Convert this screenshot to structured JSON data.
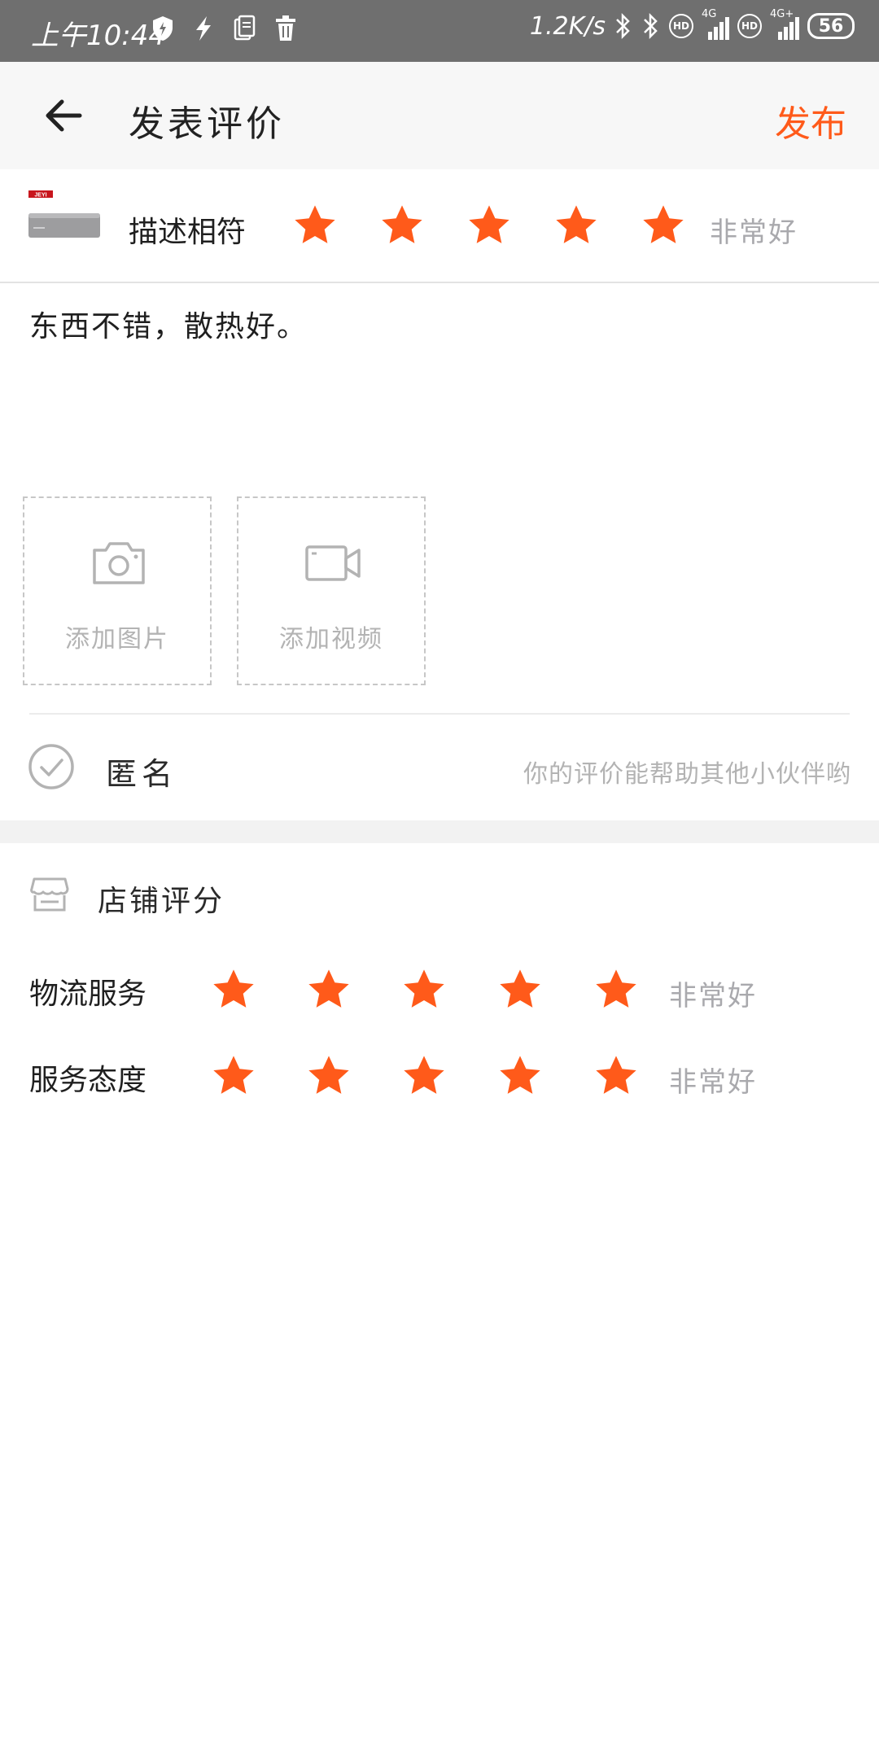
{
  "status_bar": {
    "time": "上午10:44",
    "net_speed": "1.2K/s",
    "network_1": "4G",
    "network_2": "4G+",
    "hd_badge": "HD",
    "battery": "56"
  },
  "header": {
    "title": "发表评价",
    "publish_label": "发布"
  },
  "product": {
    "brand_text": "JEYI",
    "rating_label": "描述相符",
    "rating_value": 5,
    "rating_text": "非常好"
  },
  "review": {
    "text": "东西不错，散热好。"
  },
  "uploads": {
    "add_photo": "添加图片",
    "add_video": "添加视频"
  },
  "anonymous": {
    "label": "匿名",
    "hint": "你的评价能帮助其他小伙伴哟"
  },
  "store": {
    "title": "店铺评分",
    "logistics_label": "物流服务",
    "logistics_value": 5,
    "logistics_text": "非常好",
    "service_label": "服务态度",
    "service_value": 5,
    "service_text": "非常好"
  },
  "colors": {
    "accent": "#ff5a1a",
    "muted": "#a9a9ad"
  }
}
